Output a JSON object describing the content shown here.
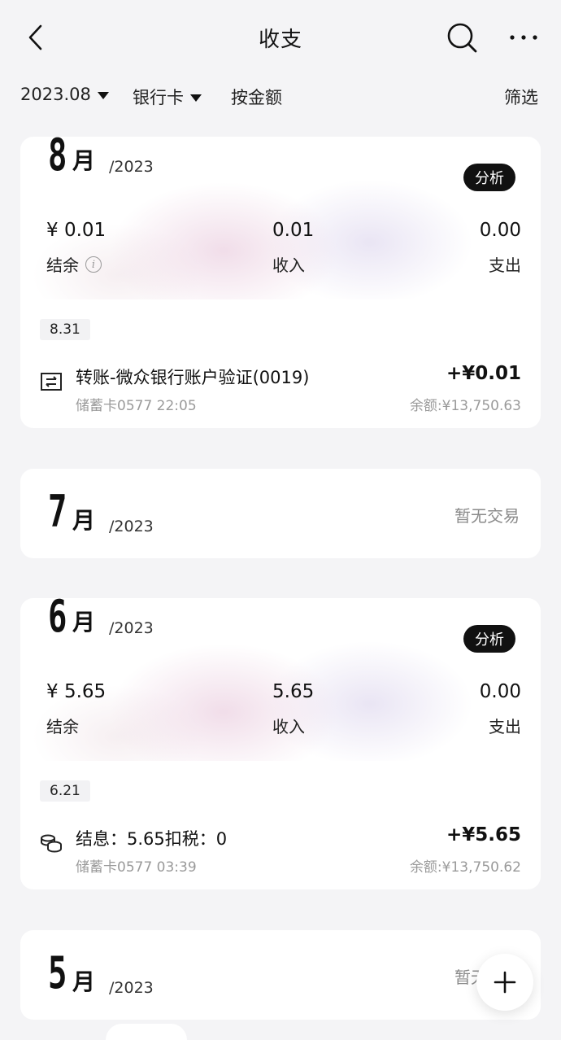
{
  "header": {
    "title": "收支"
  },
  "filters": {
    "month": "2023.08",
    "account": "银行卡",
    "sort": "按金额",
    "filter": "筛选"
  },
  "months": [
    {
      "month": "8",
      "unit": "月",
      "year": "/2023",
      "analysis_label": "分析",
      "balance_value": "¥ 0.01",
      "balance_label": "结余",
      "income_value": "0.01",
      "income_label": "收入",
      "expense_value": "0.00",
      "expense_label": "支出",
      "date": "8.31",
      "tx_title": "转账-微众银行账户验证(0019)",
      "tx_sub": "储蓄卡0577 22:05",
      "tx_amount": "+¥0.01",
      "tx_balance": "余额:¥13,750.63"
    },
    {
      "month": "7",
      "unit": "月",
      "year": "/2023",
      "empty_label": "暂无交易"
    },
    {
      "month": "6",
      "unit": "月",
      "year": "/2023",
      "analysis_label": "分析",
      "balance_value": "¥ 5.65",
      "balance_label": "结余",
      "income_value": "5.65",
      "income_label": "收入",
      "expense_value": "0.00",
      "expense_label": "支出",
      "date": "6.21",
      "tx_title": "结息：5.65扣税：0",
      "tx_sub": "储蓄卡0577 03:39",
      "tx_amount": "+¥5.65",
      "tx_balance": "余额:¥13,750.62"
    },
    {
      "month": "5",
      "unit": "月",
      "year": "/2023",
      "empty_label": "暂无交易"
    }
  ],
  "icons": {
    "back": "back-arrow-icon",
    "search": "search-icon",
    "more": "more-icon",
    "transfer": "transfer-icon",
    "interest": "coins-icon",
    "add": "plus-icon"
  }
}
